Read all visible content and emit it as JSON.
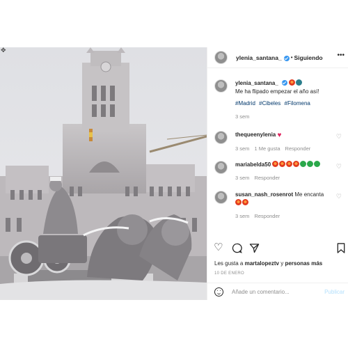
{
  "post": {
    "author": "ylenia_santana_",
    "follow_label": "Siguiendo",
    "dot": "•",
    "caption_text": "Me ha flipado empezar el año así!",
    "hashtags": [
      "#Madrid",
      "#Cibeles",
      "#Filomena"
    ],
    "caption_time": "3 sem"
  },
  "comments": [
    {
      "user": "thequeenylenia",
      "text": "",
      "time": "3 sem",
      "likes": "1 Me gusta",
      "reply": "Responder"
    },
    {
      "user": "mariabelda50",
      "text": "",
      "time": "3 sem",
      "reply": "Responder"
    },
    {
      "user": "susan_nash_rosenrot",
      "text": "Me encanta",
      "time": "3 sem",
      "reply": "Responder"
    }
  ],
  "likes": {
    "prefix": "Les gusta a",
    "user": "martalopeztv",
    "middle": "y",
    "others": "personas más"
  },
  "date": "10 DE ENERO",
  "add_comment": {
    "placeholder": "Añade un comentario...",
    "publish": "Publicar"
  },
  "icons": {
    "heart": "heart-icon",
    "comment": "comment-icon",
    "share": "share-icon",
    "save": "bookmark-icon",
    "more": "more-options-icon",
    "emoji": "smiley-icon"
  },
  "colors": {
    "hashtag": "#00376b",
    "verified": "#3897f0",
    "publish_disabled": "#b2dffc",
    "muted": "#8e8e8e"
  }
}
